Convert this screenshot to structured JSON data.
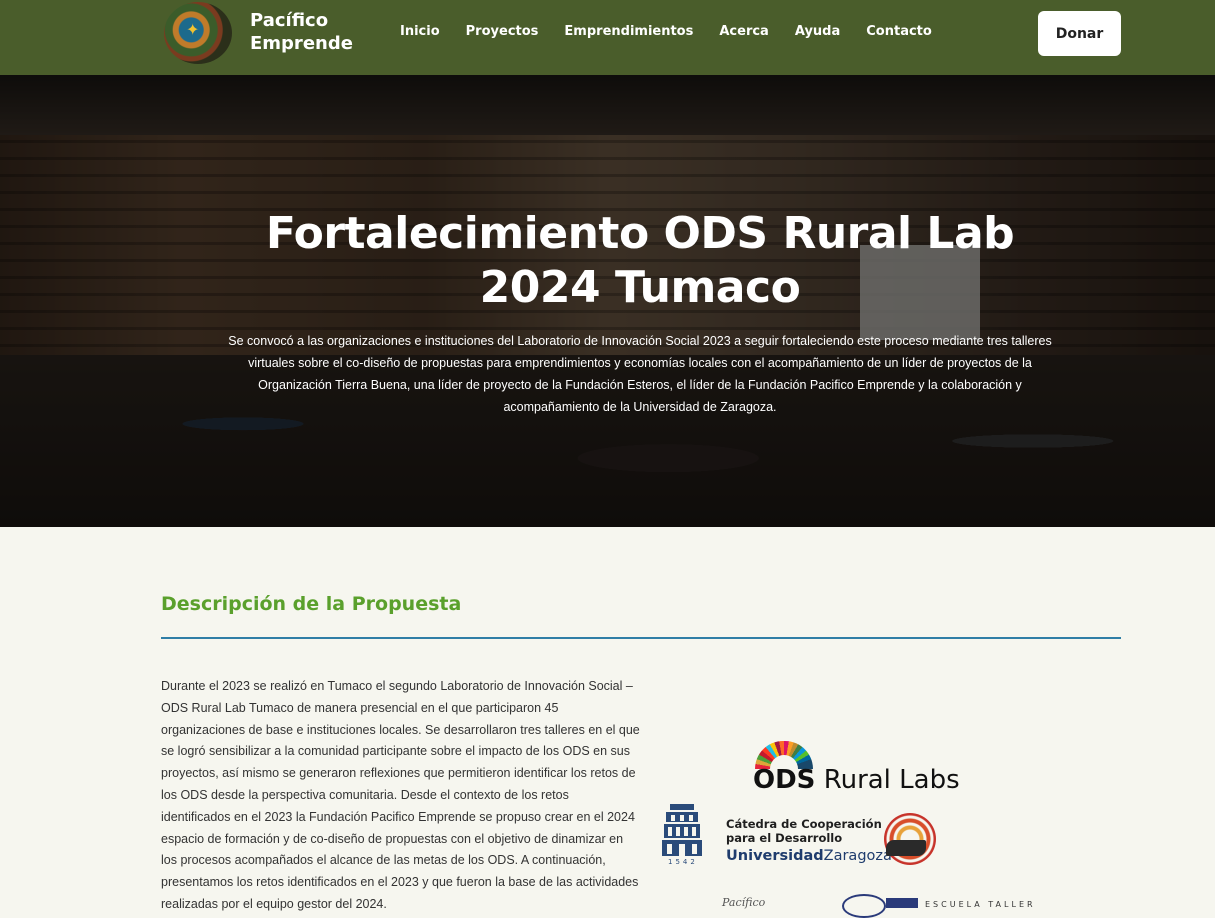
{
  "nav": {
    "brand_line1": "Pacífico",
    "brand_line2": "Emprende",
    "items": [
      "Inicio",
      "Proyectos",
      "Emprendimientos",
      "Acerca",
      "Ayuda",
      "Contacto"
    ],
    "donate_label": "Donar"
  },
  "hero": {
    "title": "Fortalecimiento ODS Rural Lab 2024 Tumaco",
    "text": "Se convocó a las organizaciones e instituciones del Laboratorio de Innovación Social 2023 a seguir fortaleciendo este proceso mediante tres talleres virtuales sobre el co-diseño de propuestas para emprendimientos y economías locales con el acompañamiento de un líder de proyectos de la Organización Tierra Buena, una líder de proyecto de la Fundación Esteros, el líder de la Fundación Pacifico Emprende y la colaboración y acompañamiento de la Universidad de Zaragoza."
  },
  "section": {
    "title": "Descripción de la Propuesta",
    "body": "Durante el 2023 se realizó en Tumaco el segundo Laboratorio de Innovación Social – ODS Rural Lab Tumaco de manera presencial en el que participaron 45 organizaciones de base e instituciones locales. Se desarrollaron tres talleres en el que se logró sensibilizar a la comunidad participante sobre el impacto de los ODS en sus proyectos, así mismo se generaron reflexiones que permitieron identificar los retos de los ODS desde la perspectiva comunitaria. Desde el contexto de los retos identificados en el 2023 la Fundación Pacifico Emprende se propuso crear en el 2024 espacio de formación y de co-diseño de propuestas con el objetivo de dinamizar en los procesos acompañados el alcance de las metas de los ODS. A continuación, presentamos los retos identificados en el 2023 y que fueron la base de las actividades realizadas por el equipo gestor del 2024."
  },
  "logos": {
    "ods_bold": "ODS",
    "ods_rest": "Rural Labs",
    "catedra_line1": "Cátedra de Cooperación",
    "catedra_line2": "para el Desarrollo",
    "univ_bold": "Universidad",
    "univ_rest": "Zaragoza",
    "year": "1542",
    "pacifico_small": "Pacífico",
    "escuela": "ESCUELA TALLER"
  }
}
